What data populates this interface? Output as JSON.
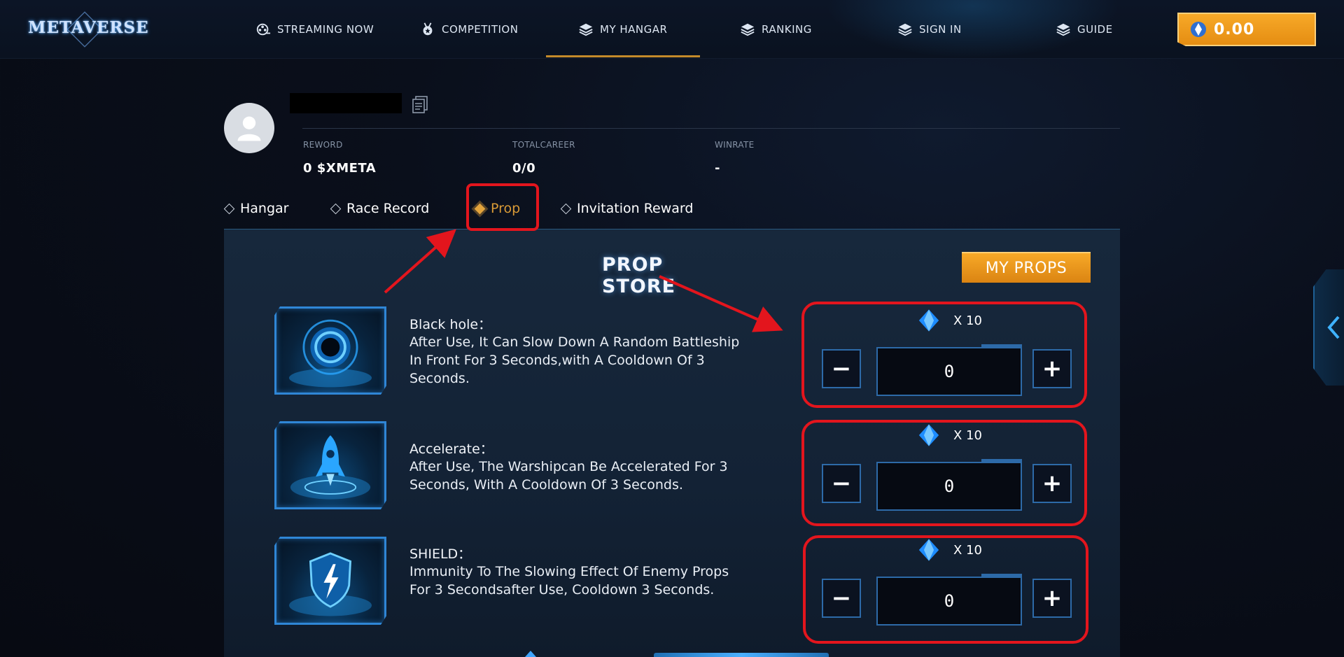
{
  "nav": {
    "logo_text": "METAVERSE",
    "items": [
      {
        "label": "STREAMING NOW",
        "icon": "film-reel-icon"
      },
      {
        "label": "COMPETITION",
        "icon": "medal-icon"
      },
      {
        "label": "MY HANGAR",
        "icon": "layers-icon",
        "active": true
      },
      {
        "label": "RANKING",
        "icon": "layers-icon"
      },
      {
        "label": "SIGN IN",
        "icon": "layers-icon"
      },
      {
        "label": "GUIDE",
        "icon": "layers-icon"
      }
    ],
    "balance": "0.00"
  },
  "profile": {
    "stats": [
      {
        "label": "REWORD",
        "value": "0 $XMETA"
      },
      {
        "label": "TOTALCAREER",
        "value": "0/0"
      },
      {
        "label": "WINRATE",
        "value": "-"
      }
    ]
  },
  "tabs": [
    {
      "label": "Hangar",
      "active": false
    },
    {
      "label": "Race Record",
      "active": false
    },
    {
      "label": "Prop",
      "active": true
    },
    {
      "label": "Invitation Reward",
      "active": false
    }
  ],
  "store": {
    "title": "PROP STORE",
    "my_props_label": "MY PROPS",
    "props": [
      {
        "name": "Black hole：",
        "description": "After Use, It Can Slow Down A Random Battleship In Front For 3 Seconds,with A Cooldown Of 3 Seconds.",
        "price": "X 10",
        "quantity": "0",
        "icon": "black-hole-icon"
      },
      {
        "name": "Accelerate：",
        "description": "After Use, The Warshipcan Be Accelerated For 3 Seconds, With A Cooldown Of 3 Seconds.",
        "price": "X 10",
        "quantity": "0",
        "icon": "rocket-icon"
      },
      {
        "name": "SHIELD：",
        "description": "Immunity To The Slowing Effect Of Enemy Props For 3 Secondsafter Use, Cooldown 3 Seconds.",
        "price": "X 10",
        "quantity": "0",
        "icon": "shield-lightning-icon"
      }
    ],
    "minus_glyph": "−",
    "plus_glyph": "+"
  },
  "colors": {
    "accent_orange": "#f7a928",
    "highlight_red": "#e3151d",
    "active_tab": "#d99a36",
    "panel_border_blue": "#2d6aa8"
  }
}
